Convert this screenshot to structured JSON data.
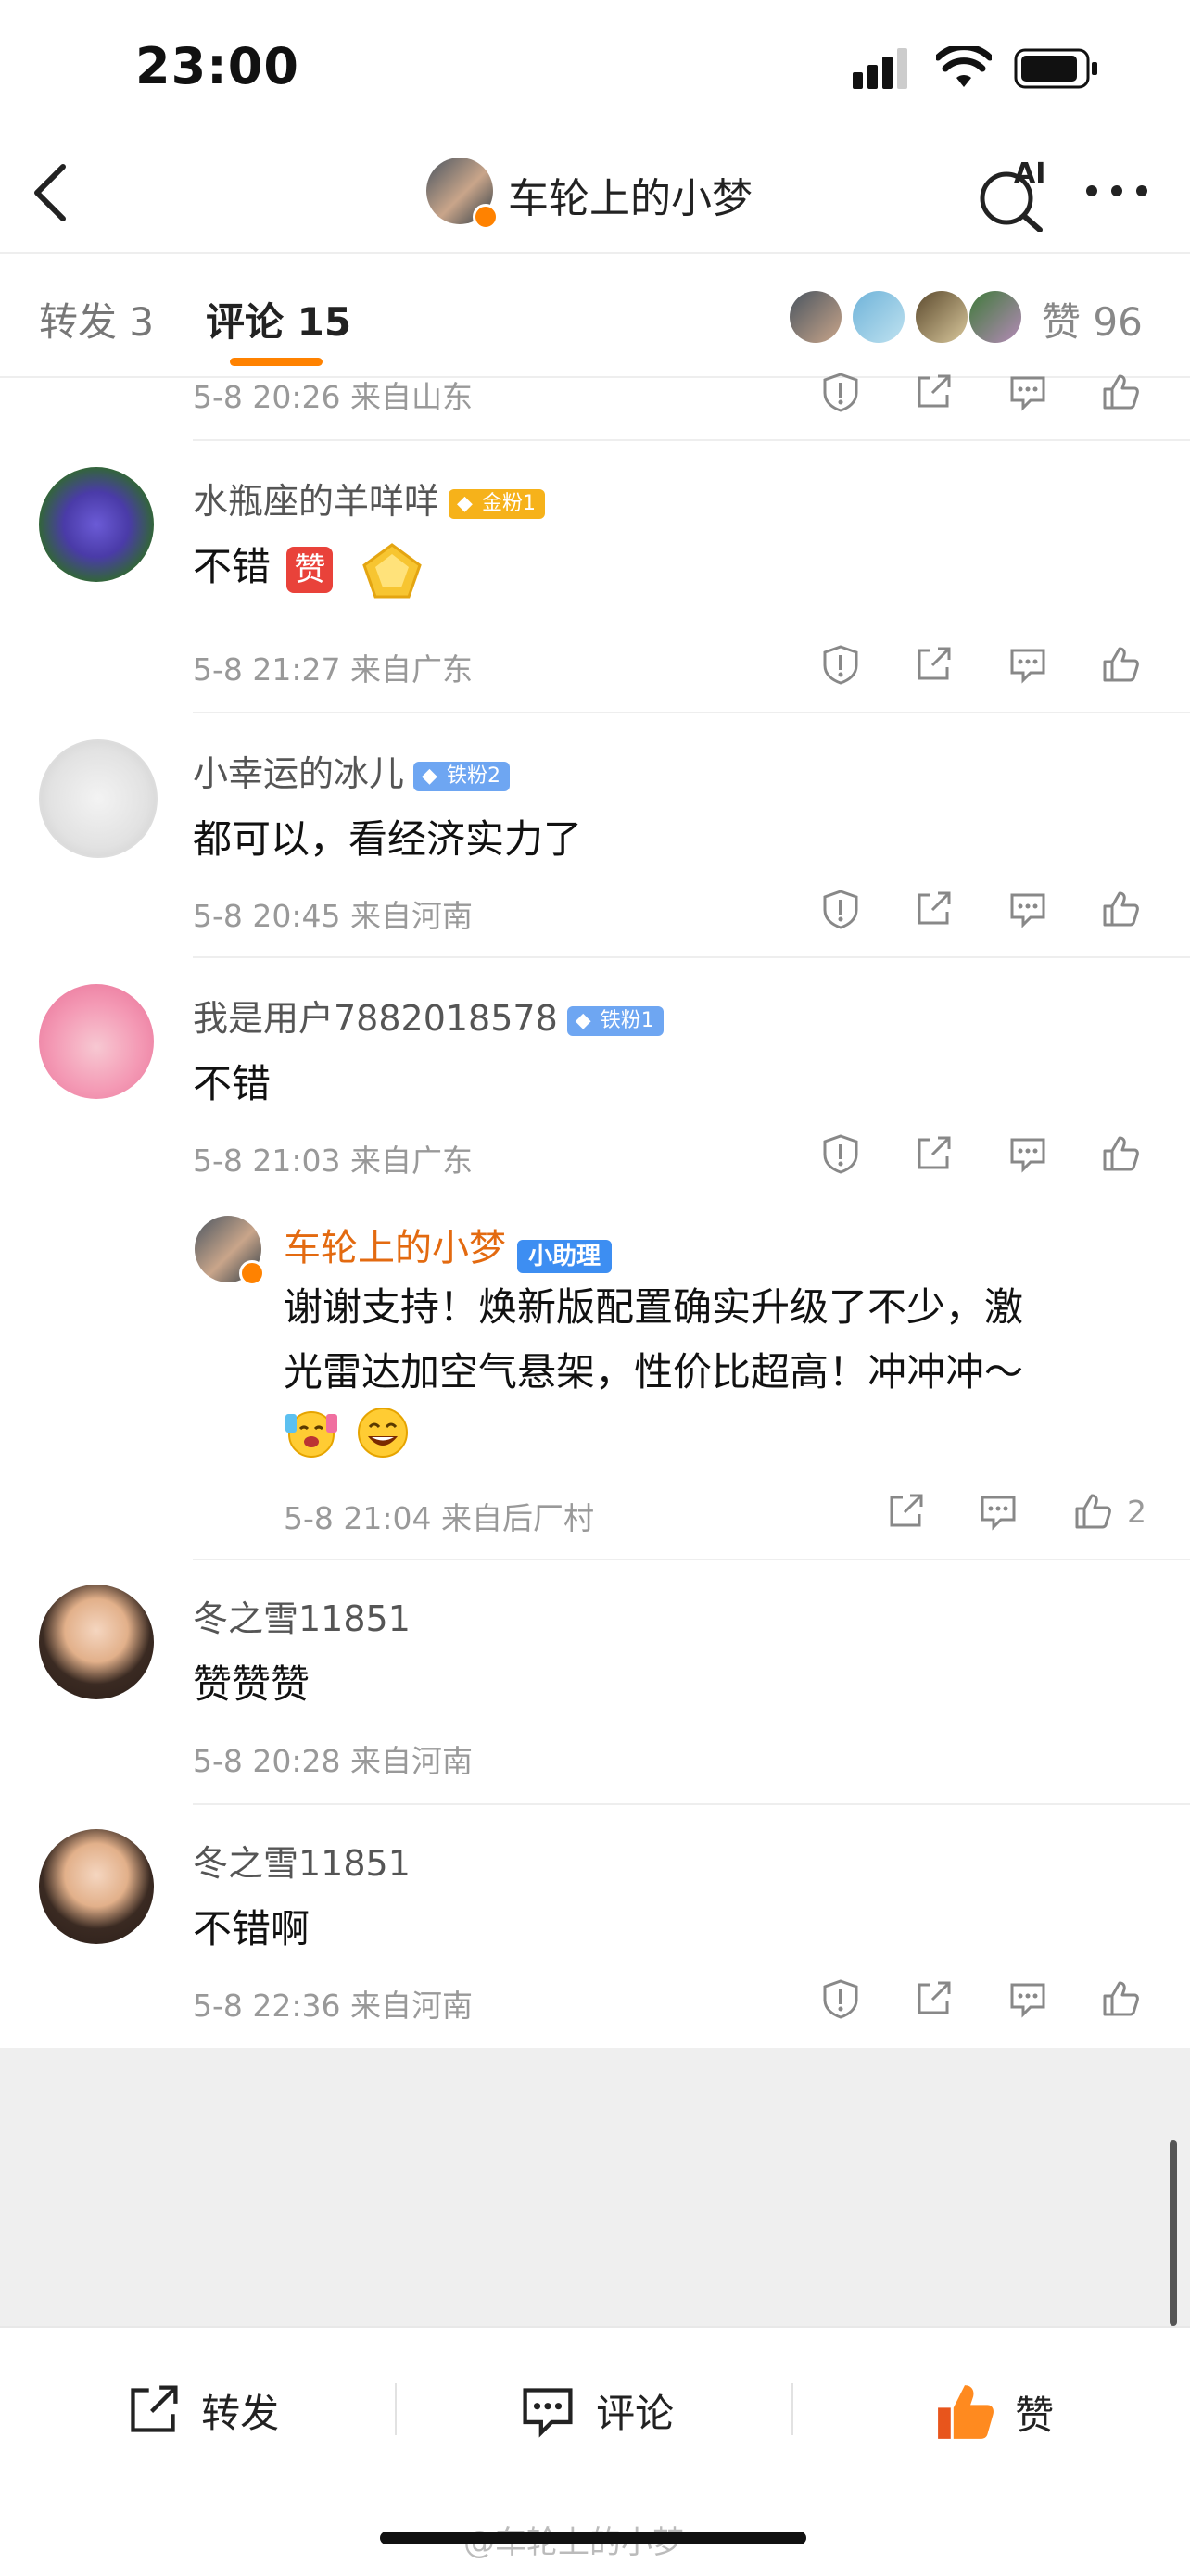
{
  "status_bar": {
    "time": "23:00"
  },
  "nav": {
    "title": "车轮上的小梦",
    "ai_label": "AI"
  },
  "tabs": {
    "repost": "转发 3",
    "comment": "评论 15",
    "likes": "赞 96"
  },
  "comments": [
    {
      "meta": "5-8 20:26 来自山东"
    },
    {
      "user": "水瓶座的羊咩咩",
      "badge": "金粉1",
      "text": "不错",
      "sticker_char": "赞",
      "meta": "5-8 21:27 来自广东"
    },
    {
      "user": "小幸运的冰儿",
      "badge": "铁粉2",
      "text": "都可以，看经济实力了",
      "meta": "5-8 20:45 来自河南"
    },
    {
      "user": "我是用户7882018578",
      "badge": "铁粉1",
      "text": "不错",
      "meta": "5-8 21:03 来自广东",
      "reply": {
        "user": "车轮上的小梦",
        "badge": "小助理",
        "text_line1": "谢谢支持！焕新版配置确实升级了不少，激",
        "text_line2": "光雷达加空气悬架，性价比超高！冲冲冲～",
        "meta": "5-8 21:04 来自后厂村",
        "like_count": "2"
      }
    },
    {
      "user": "冬之雪11851",
      "text": "赞赞赞",
      "meta": "5-8 20:28 来自河南"
    },
    {
      "user": "冬之雪11851",
      "text": "不错啊",
      "meta": "5-8 22:36 来自河南"
    }
  ],
  "bottom_bar": {
    "repost": "转发",
    "comment": "评论",
    "like": "赞"
  },
  "watermark": "@车轮上的小梦",
  "colors": {
    "accent": "#ff8200",
    "badge_gold": "#f6b21a",
    "badge_iron": "#6ea6f2",
    "assistant": "#3d8ef2"
  }
}
